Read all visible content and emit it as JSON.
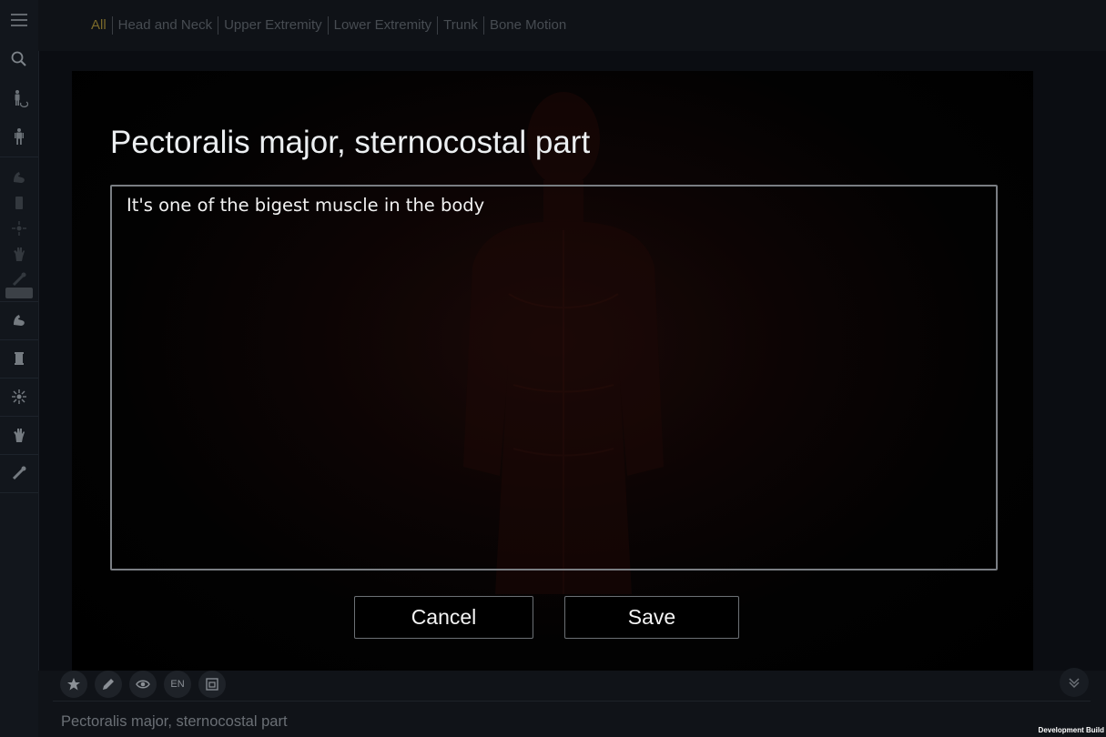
{
  "nav": {
    "tabs": [
      {
        "label": "All",
        "active": true
      },
      {
        "label": "Head and Neck"
      },
      {
        "label": "Upper Extremity"
      },
      {
        "label": "Lower Extremity"
      },
      {
        "label": "Trunk"
      },
      {
        "label": "Bone Motion"
      }
    ]
  },
  "sidebar": {
    "icons": [
      "menu-icon",
      "search-icon",
      "body-rotate-icon",
      "body-icon",
      "muscle-icon",
      "bone-icon",
      "nerve-icon",
      "hand-icon",
      "tool-icon",
      "muscle-icon",
      "bone-icon",
      "nerve-icon",
      "hand-icon",
      "tool-icon"
    ]
  },
  "dialog": {
    "title": "Pectoralis major, sternocostal part",
    "note_text": "It's one of the bigest muscle in the body",
    "cancel_label": "Cancel",
    "save_label": "Save"
  },
  "toolbar": {
    "language_label": "EN",
    "icons": [
      "star-icon",
      "pencil-icon",
      "eye-icon",
      "language-icon",
      "copy-icon",
      "chevron-double-down-icon"
    ]
  },
  "footer": {
    "selected_structure": "Pectoralis major, sternocostal part",
    "build_label": "Development Build"
  },
  "colors": {
    "active_tab": "#7b6a2a",
    "inactive_tab": "#474c52",
    "dialog_text": "#eceff1",
    "border": "#7a7e83"
  }
}
